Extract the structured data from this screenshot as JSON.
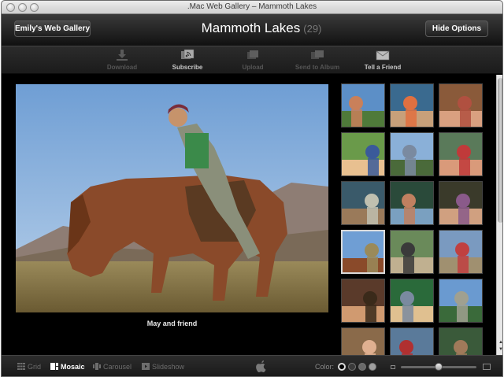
{
  "window": {
    "title": ".Mac Web Gallery – Mammoth Lakes"
  },
  "header": {
    "gallery_button": "Emily's Web Gallery",
    "album_title": "Mammoth Lakes",
    "album_count": "(29)",
    "hide_options_button": "Hide Options"
  },
  "toolbar": {
    "download": "Download",
    "subscribe": "Subscribe",
    "upload": "Upload",
    "send_to_album": "Send to Album",
    "tell_a_friend": "Tell a Friend"
  },
  "photo": {
    "caption": "May and friend"
  },
  "thumbnails": {
    "selected_index": 9,
    "items": [
      "lake-portrait",
      "girl-sitting",
      "girl-smile",
      "blonde-girl",
      "lake-view",
      "girl-red",
      "boat-group",
      "boat-rowing",
      "two-kids",
      "horse-rider",
      "biker-1",
      "biker-2",
      "smiling-girl",
      "couple-green",
      "mountain-lake",
      "group-1",
      "group-2",
      "group-3"
    ]
  },
  "bottombar": {
    "views": [
      {
        "label": "Grid",
        "active": false
      },
      {
        "label": "Mosaic",
        "active": true
      },
      {
        "label": "Carousel",
        "active": false
      },
      {
        "label": "Slideshow",
        "active": false
      }
    ],
    "color_label": "Color:",
    "color_swatches": [
      "#000000",
      "#3a3a3a",
      "#6a6a6a",
      "#a0a0a0"
    ],
    "size_slider_value": 0.5
  },
  "icons": {
    "download": "download-arrow-icon",
    "subscribe": "rss-feed-icon",
    "upload": "upload-photos-icon",
    "send_to_album": "send-photos-icon",
    "tell_a_friend": "envelope-icon"
  },
  "colors": {
    "toolbar_bg": "#1e1e1e",
    "selected_border": "#d9d9d9"
  }
}
